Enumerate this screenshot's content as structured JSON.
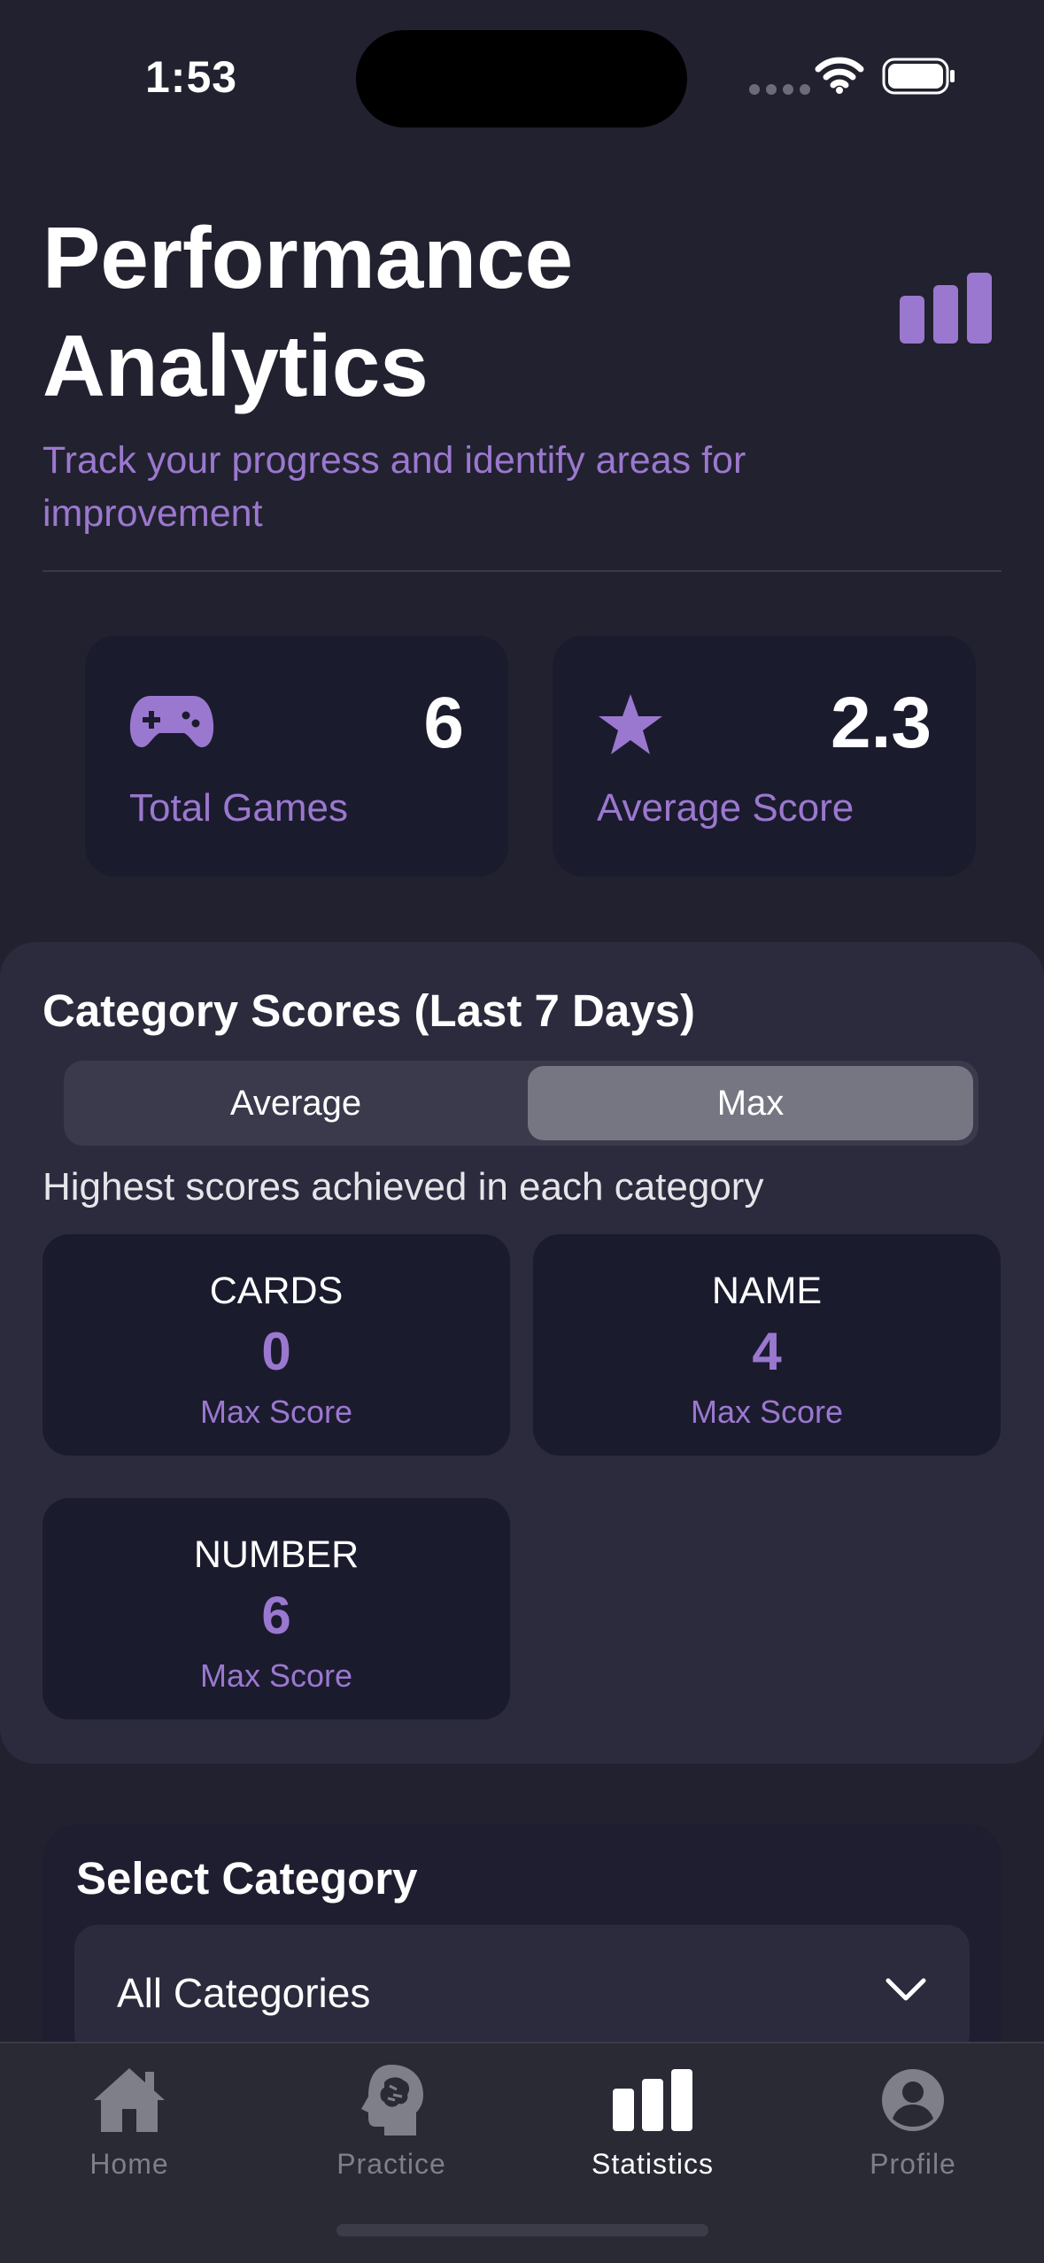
{
  "status_bar": {
    "time": "1:53"
  },
  "header": {
    "title": "Performance Analytics",
    "subtitle": "Track your progress and identify areas for improvement",
    "icon": "bar-chart-icon"
  },
  "stats": [
    {
      "icon": "gamepad-icon",
      "value": "6",
      "label": "Total Games"
    },
    {
      "icon": "star-icon",
      "value": "2.3",
      "label": "Average Score"
    }
  ],
  "category_scores": {
    "title": "Category Scores (Last 7 Days)",
    "segments": [
      "Average",
      "Max"
    ],
    "selected_segment": "Max",
    "description": "Highest scores achieved in each category",
    "tiles": [
      {
        "name": "CARDS",
        "value": "0",
        "label": "Max Score"
      },
      {
        "name": "NAME",
        "value": "4",
        "label": "Max Score"
      },
      {
        "name": "NUMBER",
        "value": "6",
        "label": "Max Score"
      }
    ]
  },
  "select_category": {
    "title": "Select Category",
    "value": "All Categories"
  },
  "tab_bar": {
    "items": [
      {
        "label": "Home",
        "icon": "home-icon"
      },
      {
        "label": "Practice",
        "icon": "brain-head-icon"
      },
      {
        "label": "Statistics",
        "icon": "bar-chart-icon"
      },
      {
        "label": "Profile",
        "icon": "profile-icon"
      }
    ],
    "active": "Statistics"
  },
  "colors": {
    "background": "#22212f",
    "accent": "#9b78cf",
    "card": "#1b1b2e",
    "section": "#2c2b3d"
  }
}
